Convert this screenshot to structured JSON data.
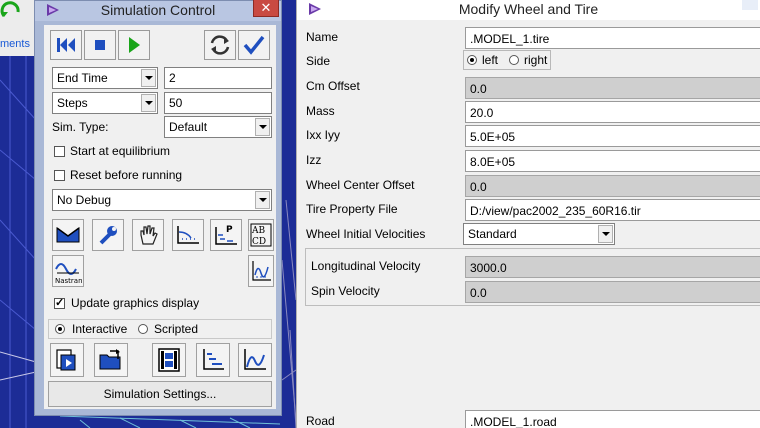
{
  "background": {
    "tab_label": "ments"
  },
  "sim_control": {
    "title": "Simulation Control",
    "close_symbol": "✕",
    "end_time_mode": "End Time",
    "end_time_value": "2",
    "steps_mode": "Steps",
    "steps_value": "50",
    "sim_type_label": "Sim. Type:",
    "sim_type_value": "Default",
    "start_at_equilibrium": "Start at equilibrium",
    "reset_before_running": "Reset before running",
    "debug_value": "No Debug",
    "nastran_label": "Nastran",
    "update_graphics": "Update graphics display",
    "interactive": "Interactive",
    "scripted": "Scripted",
    "settings_button": "Simulation Settings..."
  },
  "wheel_tire": {
    "title": "Modify Wheel and Tire",
    "fields": {
      "name_label": "Name",
      "name_value": ".MODEL_1.tire",
      "side_label": "Side",
      "side_left": "left",
      "side_right": "right",
      "cm_offset_label": "Cm Offset",
      "cm_offset_value": "0.0",
      "mass_label": "Mass",
      "mass_value": "20.0",
      "ixx_label": "Ixx Iyy",
      "ixx_value": "5.0E+05",
      "izz_label": "Izz",
      "izz_value": "8.0E+05",
      "wco_label": "Wheel Center Offset",
      "wco_value": "0.0",
      "tpf_label": "Tire Property File",
      "tpf_value": "D:/view/pac2002_235_60R16.tir",
      "wiv_label": "Wheel Initial Velocities",
      "wiv_value": "Standard",
      "long_vel_label": "Longitudinal Velocity",
      "long_vel_value": "3000.0",
      "spin_vel_label": "Spin Velocity",
      "spin_vel_value": "0.0",
      "road_label": "Road",
      "road_value": ".MODEL_1.road"
    }
  },
  "colors": {
    "viewport_bg": "#1c2c96",
    "panel_frame": "#a9b8d6",
    "accent_green": "#1aa51a",
    "accent_blue": "#1f4fbf"
  }
}
